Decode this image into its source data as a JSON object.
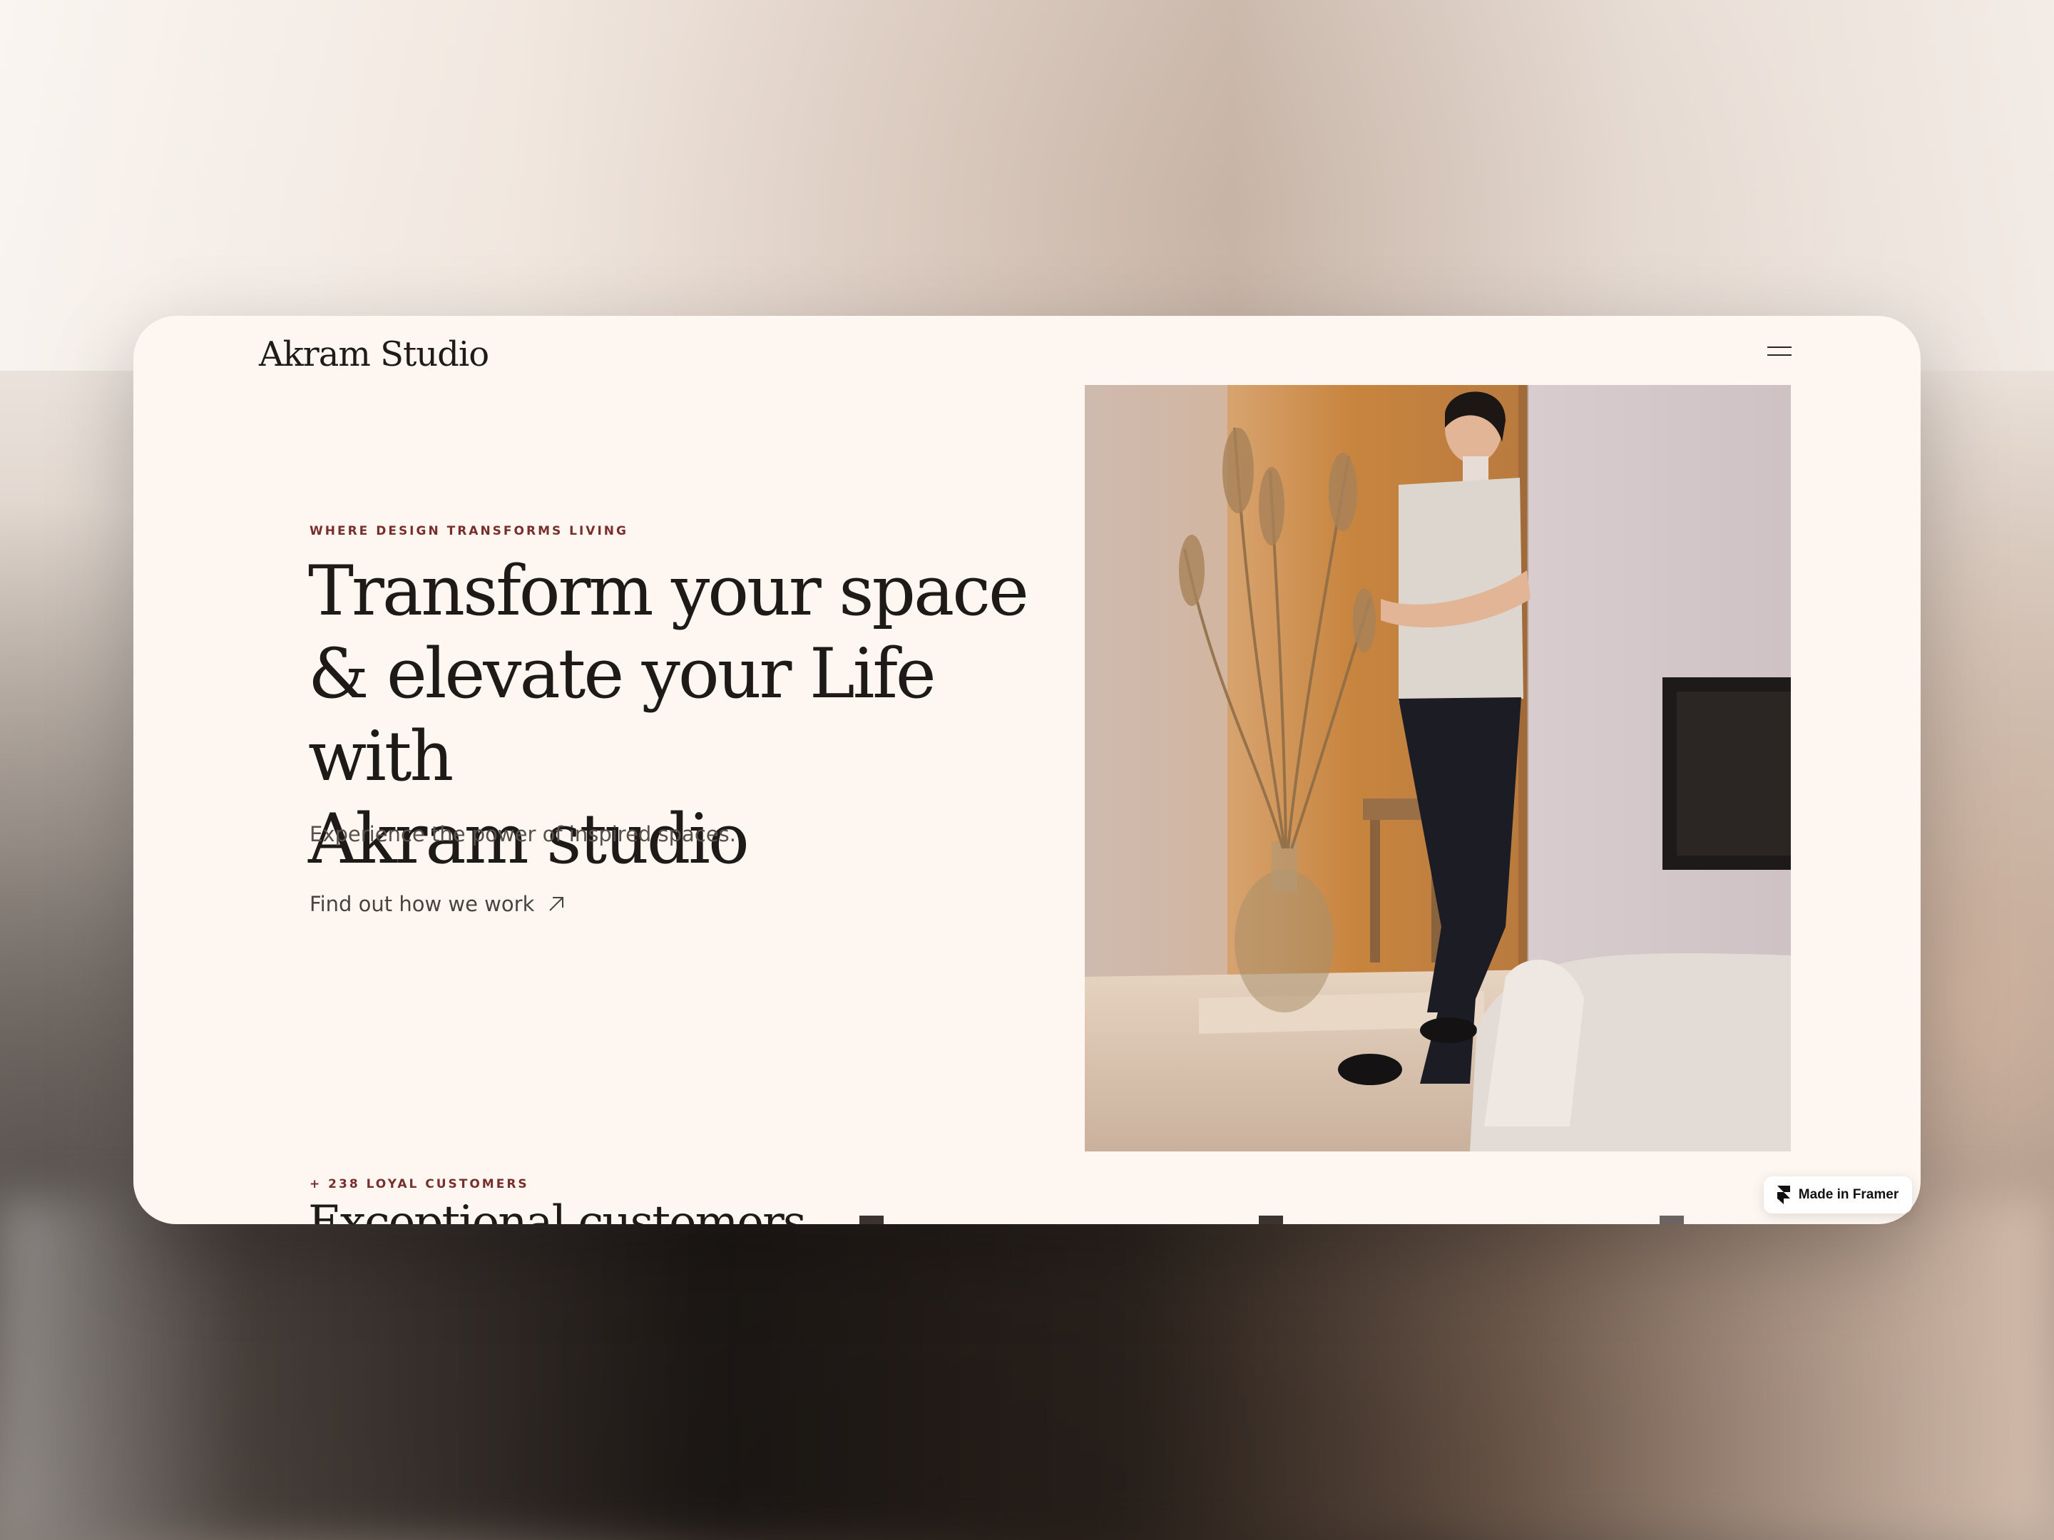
{
  "site": {
    "logo": "Akram Studio",
    "menu_icon": "hamburger-icon"
  },
  "hero": {
    "eyebrow": "WHERE DESIGN TRANSFORMS LIVING",
    "headline_line1": "Transform your space",
    "headline_line2": "& elevate your Life with",
    "headline_line3": "Akram studio",
    "subtext": "Experience the power of inspired spaces.",
    "cta_label": "Find out how we work",
    "cta_icon": "arrow-up-right-icon"
  },
  "customers": {
    "eyebrow": "+ 238 LOYAL CUSTOMERS",
    "heading": "Exceptional customers"
  },
  "badge": {
    "label": "Made in Framer",
    "icon": "framer-icon"
  },
  "colors": {
    "page_bg": "#fdf6f1",
    "accent": "#7a2e2c",
    "text": "#1e1a17"
  }
}
